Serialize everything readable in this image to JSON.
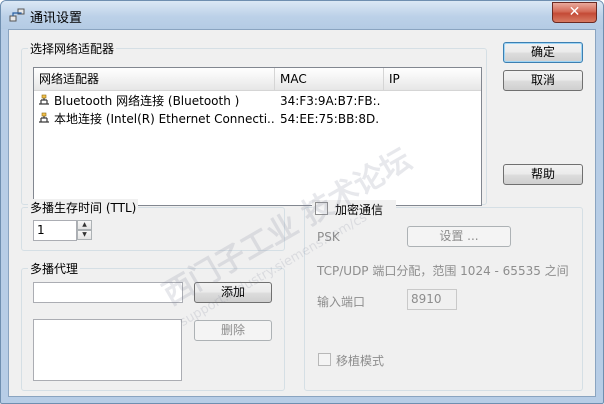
{
  "window": {
    "title": "通讯设置",
    "close_label": "✕"
  },
  "adapters_group": {
    "label": "选择网络适配器",
    "columns": [
      "网络适配器",
      "MAC",
      "IP"
    ],
    "rows": [
      {
        "name": "Bluetooth 网络连接 (Bluetooth )",
        "mac": "34:F3:9A:B7:FB:...",
        "ip": ""
      },
      {
        "name": "本地连接 (Intel(R) Ethernet Connecti...",
        "mac": "54:EE:75:BB:8D...",
        "ip": ""
      }
    ]
  },
  "buttons": {
    "ok": "确定",
    "cancel": "取消",
    "help": "帮助"
  },
  "ttl_group": {
    "label": "多播生存时间 (TTL)",
    "value": "1"
  },
  "proxy_group": {
    "label": "多播代理",
    "input_value": "",
    "add_label": "添加",
    "delete_label": "删除"
  },
  "encryption": {
    "checkbox_label": "加密通信",
    "checked": false,
    "psk_label": "PSK",
    "settings_label": "设置 ...",
    "port_info": "TCP/UDP 端口分配，范围 1024 - 65535 之间",
    "port_label": "输入端口",
    "port_value": "8910",
    "portable_label": "移植模式"
  },
  "watermark": {
    "text": "西门子工业 技术论坛",
    "url": "support.industry.siemens.com/cs"
  }
}
